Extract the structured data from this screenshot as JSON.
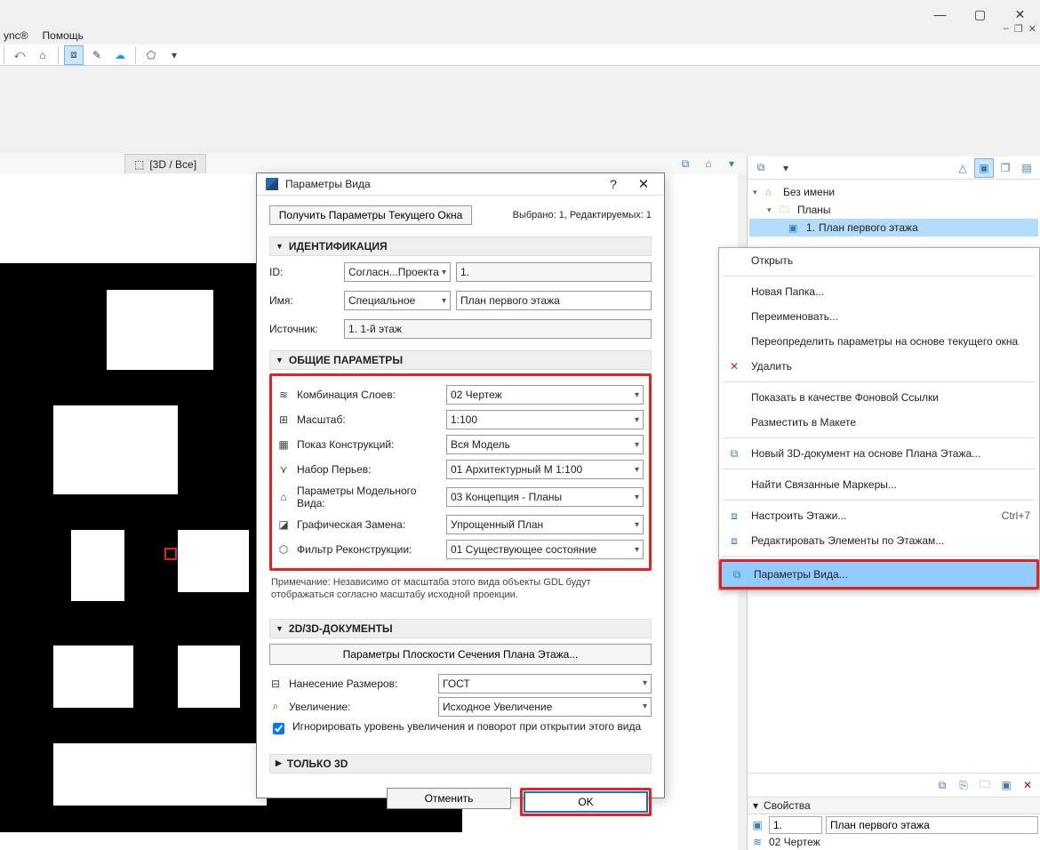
{
  "menubar": {
    "items": [
      "ync®",
      "Помощь"
    ]
  },
  "window_controls": {
    "min": "—",
    "max": "▢",
    "close": "✕",
    "mdi": {
      "min": "–",
      "max": "❐",
      "close": "✕"
    }
  },
  "tab": {
    "icon": "⬚",
    "label": "[3D / Все]"
  },
  "navigator": {
    "root": {
      "label": "Без имени"
    },
    "folder": {
      "label": "Планы"
    },
    "view": {
      "id": "1.",
      "label": "План первого этажа"
    },
    "props_head": "Свойства",
    "prop_id": "1.",
    "prop_name": "План первого этажа",
    "prop_layer": "02 Чертеж"
  },
  "context_menu": {
    "open": "Открыть",
    "new_folder": "Новая Папка...",
    "rename": "Переименовать...",
    "redefine": "Переопределить параметры на основе текущего окна",
    "delete": "Удалить",
    "show_bg": "Показать в качестве Фоновой Ссылки",
    "place_layout": "Разместить в Макете",
    "new_3d_doc": "Новый 3D-документ на основе Плана Этажа...",
    "find_markers": "Найти Связанные Маркеры...",
    "story_settings": "Настроить Этажи...",
    "story_settings_sc": "Ctrl+7",
    "edit_by_story": "Редактировать Элементы по Этажам...",
    "view_settings": "Параметры Вида..."
  },
  "dialog": {
    "title": "Параметры Вида",
    "get_current": "Получить Параметры Текущего Окна",
    "status": "Выбрано: 1, Редактируемых: 1",
    "sec_id": "ИДЕНТИФИКАЦИЯ",
    "id_label": "ID:",
    "id_mode": "Согласн...Проекта",
    "id_value": "1.",
    "name_label": "Имя:",
    "name_mode": "Специальное",
    "name_value": "План первого этажа",
    "src_label": "Источник:",
    "src_value": "1. 1-й этаж",
    "sec_general": "ОБЩИЕ ПАРАМЕТРЫ",
    "params": [
      {
        "icon": "≋",
        "label": "Комбинация Слоев:",
        "value": "02 Чертеж"
      },
      {
        "icon": "⊞",
        "label": "Масштаб:",
        "value": "1:100"
      },
      {
        "icon": "▦",
        "label": "Показ Конструкций:",
        "value": "Вся Модель"
      },
      {
        "icon": "⋎",
        "label": "Набор Перьев:",
        "value": "01 Архитектурный М 1:100"
      },
      {
        "icon": "⌂",
        "label": "Параметры Модельного Вида:",
        "value": "03 Концепция - Планы"
      },
      {
        "icon": "◪",
        "label": "Графическая Замена:",
        "value": "Упрощенный План"
      },
      {
        "icon": "⬡",
        "label": "Фильтр Реконструкции:",
        "value": "01 Существующее состояние"
      }
    ],
    "note": "Примечание: Независимо от масштаба этого вида объекты GDL будут отображаться согласно масштабу исходной проекции.",
    "sec_2d3d": "2D/3D-ДОКУМЕНТЫ",
    "cut_plane_btn": "Параметры Плоскости Сечения Плана Этажа...",
    "dim_label": "Нанесение Размеров:",
    "dim_value": "ГОСТ",
    "zoom_label": "Увеличение:",
    "zoom_value": "Исходное Увеличение",
    "ignore_cb": "Игнорировать уровень увеличения и поворот при открытии этого вида",
    "sec_3d": "ТОЛЬКО 3D",
    "cancel": "Отменить",
    "ok": "OK"
  }
}
